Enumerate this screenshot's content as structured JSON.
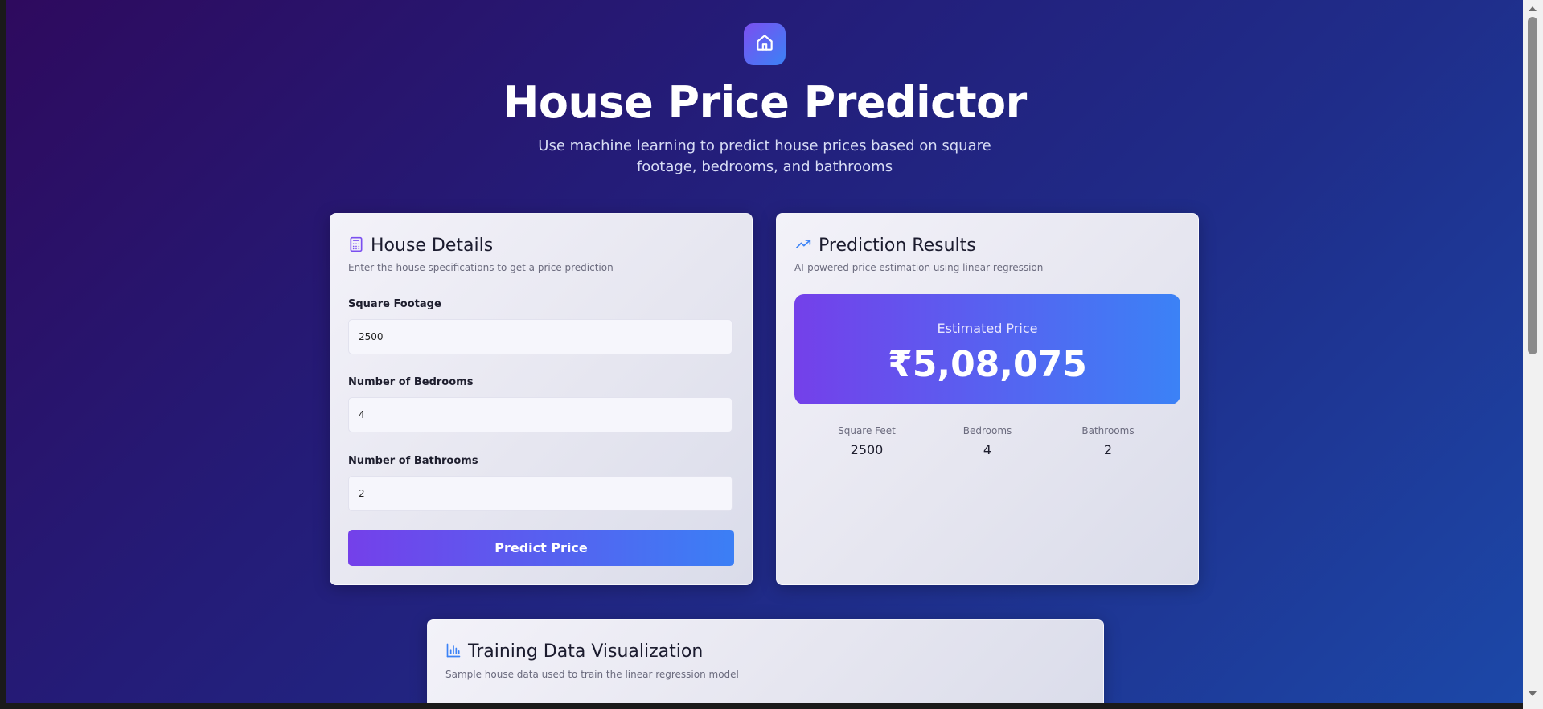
{
  "header": {
    "title": "House Price Predictor",
    "subtitle": "Use machine learning to predict house prices based on square footage, bedrooms, and bathrooms",
    "logo_icon": "home-icon"
  },
  "house_details": {
    "icon": "calculator-icon",
    "title": "House Details",
    "description": "Enter the house specifications to get a price prediction",
    "fields": [
      {
        "label": "Square Footage",
        "value": "2500"
      },
      {
        "label": "Number of Bedrooms",
        "value": "4"
      },
      {
        "label": "Number of Bathrooms",
        "value": "2"
      }
    ],
    "button_label": "Predict Price"
  },
  "prediction": {
    "icon": "trending-up-icon",
    "title": "Prediction Results",
    "description": "AI-powered price estimation using linear regression",
    "estimated_label": "Estimated Price",
    "estimated_value": "₹5,08,075",
    "stats": [
      {
        "label": "Square Feet",
        "value": "2500"
      },
      {
        "label": "Bedrooms",
        "value": "4"
      },
      {
        "label": "Bathrooms",
        "value": "2"
      }
    ]
  },
  "training": {
    "icon": "bar-chart-icon",
    "title": "Training Data Visualization",
    "description": "Sample house data used to train the linear regression model"
  },
  "colors": {
    "accent_purple": "#7440ea",
    "accent_blue": "#3b82f6",
    "background_start": "#2e0a5e",
    "background_end": "#1c48a8"
  }
}
